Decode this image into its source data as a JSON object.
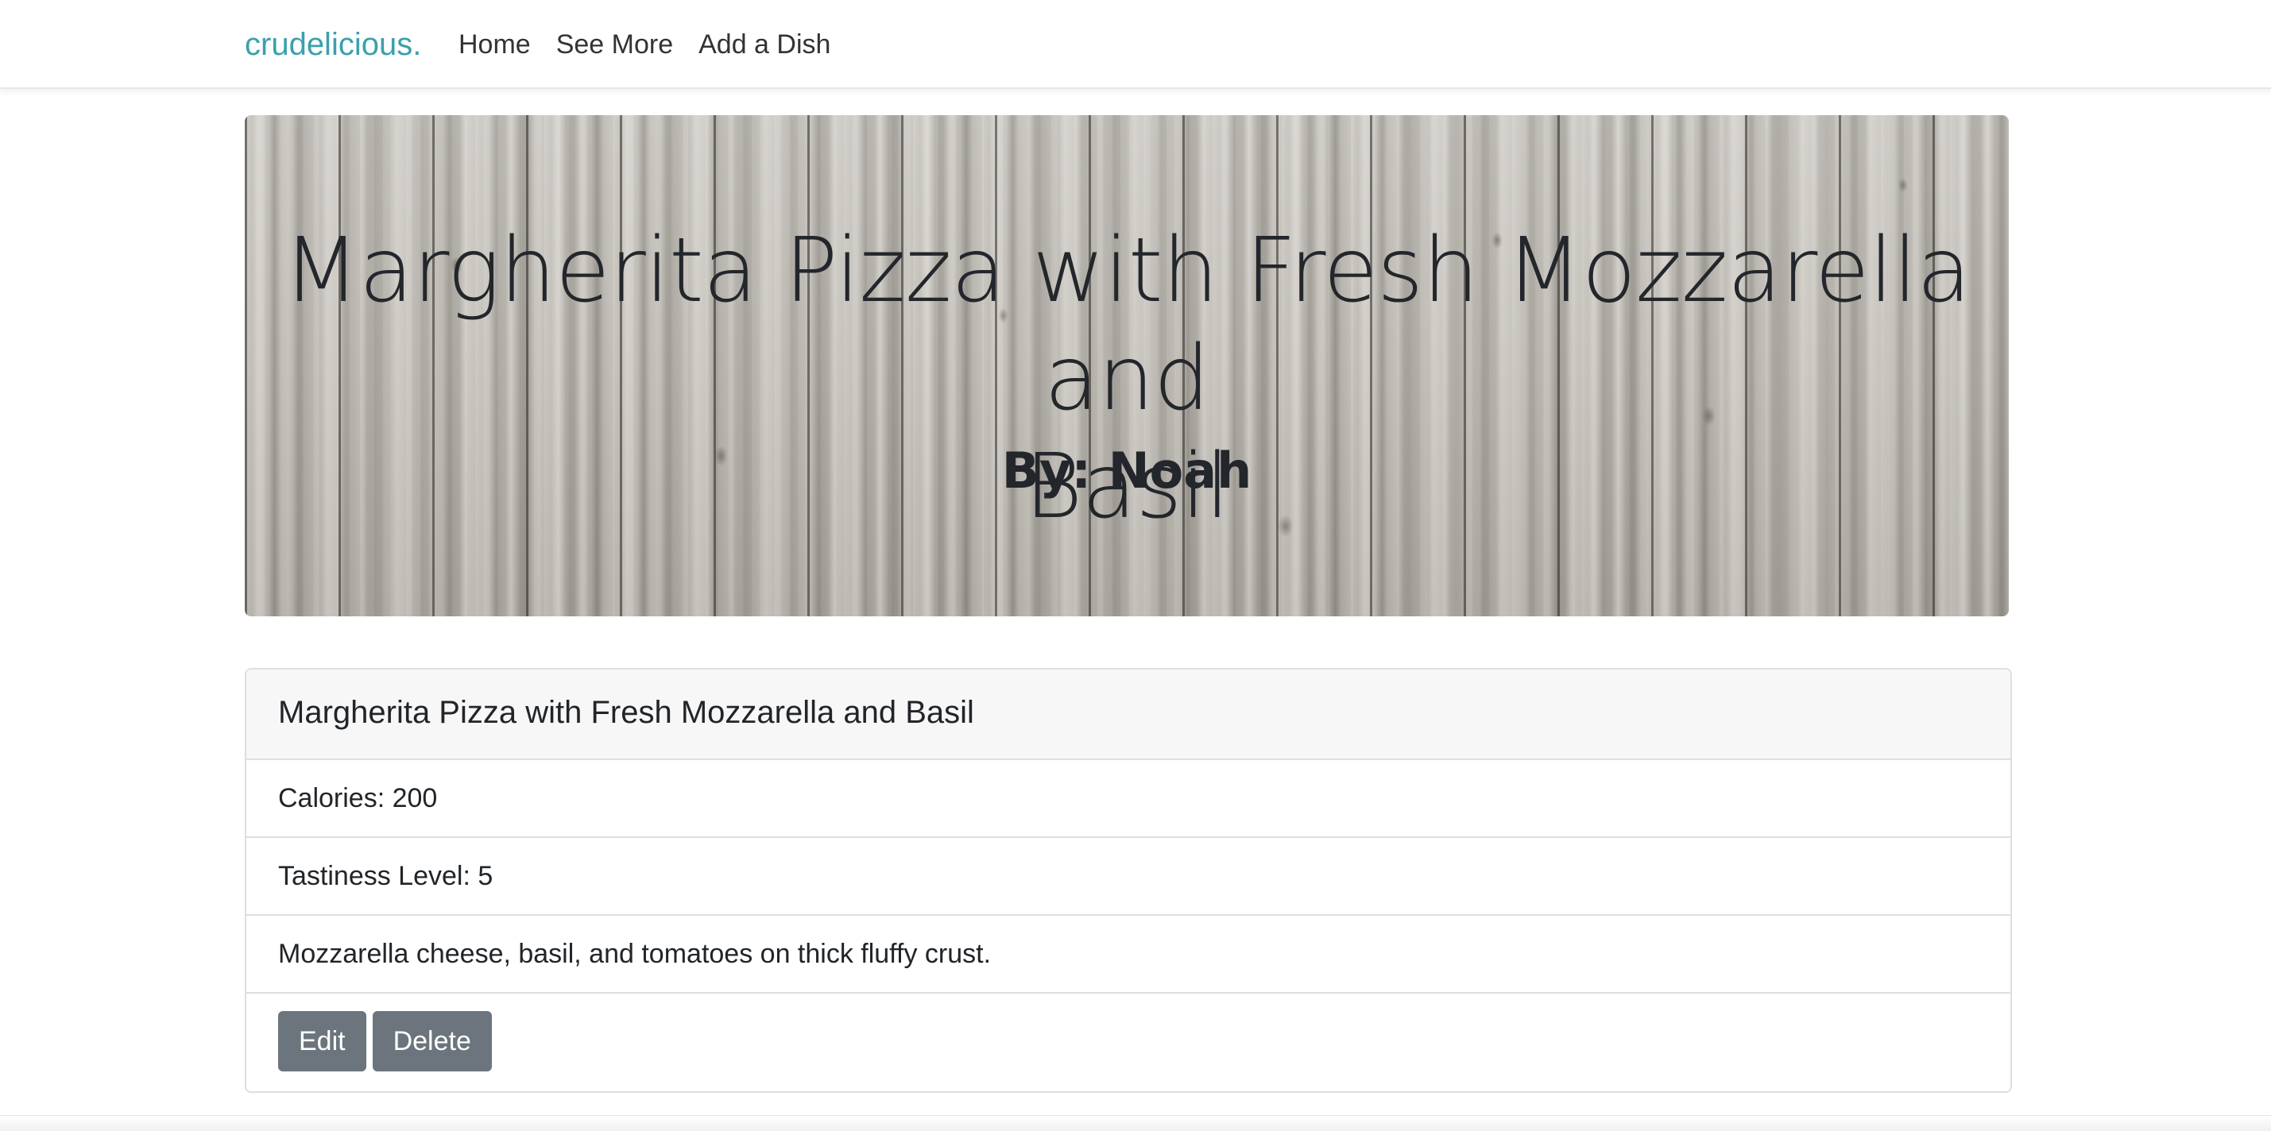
{
  "navbar": {
    "brand": "crudelicious.",
    "links": [
      "Home",
      "See More",
      "Add a Dish"
    ]
  },
  "hero": {
    "title_line1": "Margherita Pizza with Fresh Mozzarella and",
    "title_line2": "Basil",
    "byline": "By: Noah"
  },
  "dish": {
    "name": "Margherita Pizza with Fresh Mozzarella and Basil",
    "calories": "Calories: 200",
    "tastiness": "Tastiness Level: 5",
    "description": "Mozzarella cheese, basil, and tomatoes on thick fluffy crust.",
    "edit_label": "Edit",
    "delete_label": "Delete"
  },
  "colors": {
    "brand": "#3aa0ad",
    "button": "#6c757d",
    "card_header_bg": "#f7f7f7"
  }
}
